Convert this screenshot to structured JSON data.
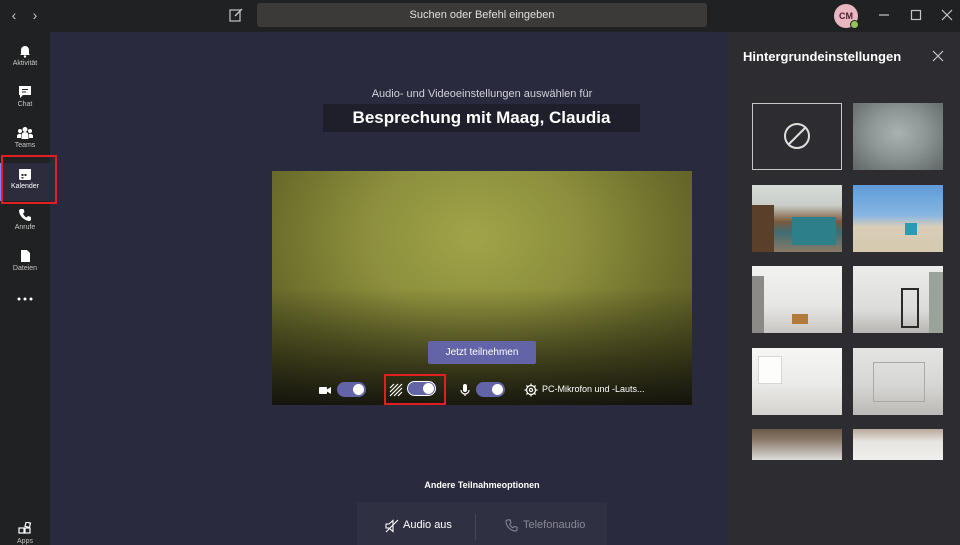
{
  "topbar": {
    "search_placeholder": "Suchen oder Befehl eingeben",
    "avatar_initials": "CM",
    "presence_color": "#92c353"
  },
  "rail": {
    "items": [
      {
        "label": "Aktivität",
        "icon": "bell-icon"
      },
      {
        "label": "Chat",
        "icon": "chat-icon"
      },
      {
        "label": "Teams",
        "icon": "teams-icon"
      },
      {
        "label": "Kalender",
        "icon": "calendar-icon",
        "active": true
      },
      {
        "label": "Anrufe",
        "icon": "phone-icon"
      },
      {
        "label": "Dateien",
        "icon": "file-icon"
      },
      {
        "label": "Apps",
        "icon": "apps-icon"
      }
    ]
  },
  "main": {
    "subtitle": "Audio- und Videoeinstellungen auswählen für",
    "meeting_title": "Besprechung mit Maag, Claudia",
    "join_label": "Jetzt teilnehmen",
    "device_label": "PC-Mikrofon und -Lauts...",
    "camera_on": true,
    "background_blur_on": true,
    "mic_on": true,
    "other_options_label": "Andere Teilnahmeoptionen",
    "audio_off_label": "Audio aus",
    "phone_audio_label": "Telefonaudio"
  },
  "background_panel": {
    "title": "Hintergrundeinstellungen",
    "thumbnails": [
      "none-icon",
      "blur",
      "office",
      "beach",
      "loft",
      "white-room",
      "bright-room",
      "studio",
      "brick-loft",
      "white-space"
    ]
  },
  "colors": {
    "accent": "#6264a7",
    "highlight": "#e02020",
    "app_bg": "#292a3e",
    "panel_bg": "#2d2c30"
  }
}
